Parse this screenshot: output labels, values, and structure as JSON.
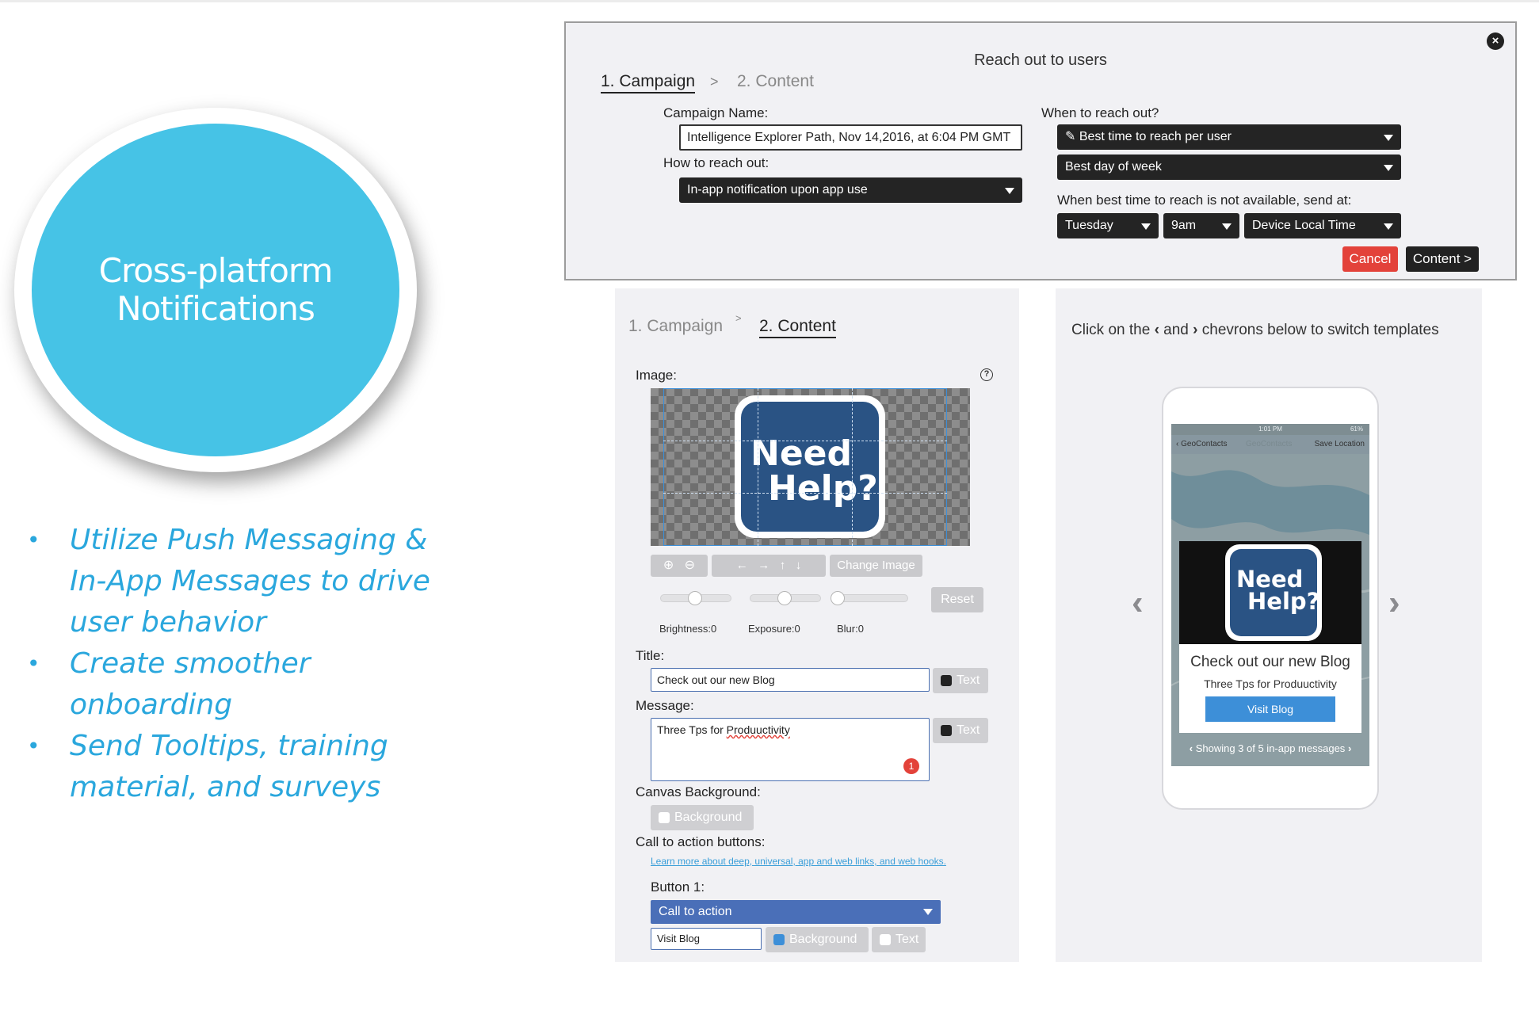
{
  "slide": {
    "circle_title": "Cross-platform Notifications",
    "bullets": [
      "Utilize Push Messaging & In-App Messages to drive user behavior",
      "Create smoother onboarding",
      "Send Tooltips, training material, and surveys"
    ]
  },
  "campaign_modal": {
    "title": "Reach out to users",
    "step1": "1. Campaign",
    "separator": ">",
    "step2": "2. Content",
    "campaign_name_label": "Campaign Name:",
    "campaign_name_value": "Intelligence Explorer Path, Nov 14,2016, at 6:04 PM GMT",
    "how_label": "How to reach out:",
    "how_value": "In-app notification upon app use",
    "when_label": "When to reach out?",
    "when_value": "Best time to reach per user",
    "day_value": "Best day of week",
    "fallback_label": "When best time to reach is not available, send at:",
    "fallback_day": "Tuesday",
    "fallback_hour": "9am",
    "fallback_tz": "Device Local Time",
    "cancel_label": "Cancel",
    "content_label": "Content >"
  },
  "content_panel": {
    "step1": "1. Campaign",
    "separator": ">",
    "step2": "2. Content",
    "image_label": "Image:",
    "help_icon": "?",
    "need_help_line1": "Need",
    "need_help_line2": "Help?",
    "change_image_label": "Change Image",
    "reset_label": "Reset",
    "brightness_label": "Brightness:0",
    "exposure_label": "Exposure:0",
    "blur_label": "Blur:0",
    "title_label": "Title:",
    "title_value": "Check out our new Blog",
    "text_chip": "Text",
    "message_label": "Message:",
    "message_prefix": "Three Tps for ",
    "message_misspelled": "Produuctivity",
    "message_badge": "1",
    "canvas_bg_label": "Canvas Background:",
    "background_chip": "Background",
    "cta_label": "Call to action buttons:",
    "cta_link": "Learn more about deep, universal, app and web links, and web hooks.",
    "button1_label": "Button 1:",
    "button1_select": "Call to action",
    "button1_value": "Visit Blog"
  },
  "preview": {
    "instruction_prefix": "Click on the",
    "instruction_and": "and",
    "instruction_suffix": "chevrons below to switch templates",
    "nav_back": "GeoContacts",
    "nav_title": "GeoContacts",
    "nav_action": "Save Location",
    "status_time": "1:01 PM",
    "status_battery": "61%",
    "card_line1": "Need",
    "card_line2": "Help?",
    "card_title": "Check out our new Blog",
    "card_message": "Three Tps for Produuctivity",
    "card_button": "Visit Blog",
    "pager_text": "Showing 3 of 5 in-app messages"
  },
  "colors": {
    "circle": "#46c3e6",
    "bullet_text": "#2aa7dd",
    "cancel": "#e3423a",
    "primary_blue": "#3d8fd8",
    "need_help_navy": "#2a5384"
  }
}
